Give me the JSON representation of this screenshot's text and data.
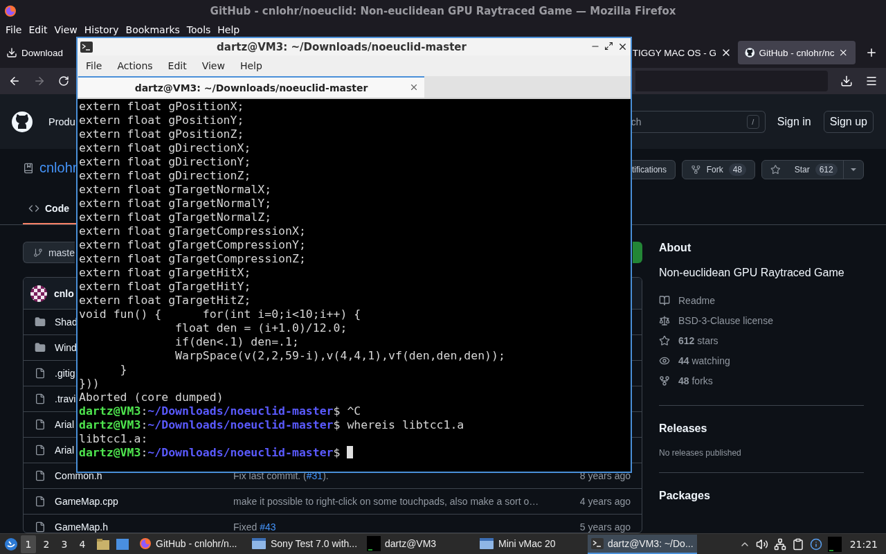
{
  "firefox": {
    "title": "GitHub - cnlohr/noeuclid: Non-euclidean GPU Raytraced Game — Mozilla Firefox",
    "menu": [
      "File",
      "Edit",
      "View",
      "History",
      "Bookmarks",
      "Tools",
      "Help"
    ],
    "tabs": [
      {
        "kind": "download",
        "label": "Download",
        "selected": false
      },
      {
        "kind": "plain",
        "label": "TIGGY MAC OS - G",
        "selected": false
      },
      {
        "kind": "site",
        "label": "GitHub - cnlohr/nc",
        "selected": true
      }
    ]
  },
  "github": {
    "header": {
      "nav_item": "Produ",
      "search_placeholder": "ch",
      "search_key": "/",
      "sign_in": "Sign in",
      "sign_up": "Sign up"
    },
    "repo": {
      "owner": "cnlohr",
      "notifications": "tifications",
      "fork": {
        "label": "Fork",
        "count": "48"
      },
      "star": {
        "label": "Star",
        "count": "612"
      }
    },
    "tabs": [
      {
        "label": "Code",
        "selected": true
      }
    ],
    "branch": "maste",
    "files": {
      "author": "cnlo",
      "rows": [
        {
          "kind": "folder",
          "name": "Shad"
        },
        {
          "kind": "folder",
          "name": "Wind"
        },
        {
          "kind": "file",
          "name": ".gitig"
        },
        {
          "kind": "file",
          "name": ".travi"
        },
        {
          "kind": "file",
          "name": "Arial"
        },
        {
          "kind": "file",
          "name": "Arial"
        },
        {
          "kind": "file",
          "name": "Common.h",
          "message": [
            {
              "text": "Fix last commit. (",
              "link": false
            },
            {
              "text": "#31",
              "link": true
            },
            {
              "text": ").",
              "link": false
            }
          ],
          "time": "8 years ago"
        },
        {
          "kind": "file",
          "name": "GameMap.cpp",
          "message": [
            {
              "text": "make it possible to right-click on some touchpads, also make a sort o…",
              "link": false
            }
          ],
          "time": "4 years ago"
        },
        {
          "kind": "file",
          "name": "GameMap.h",
          "message": [
            {
              "text": "Fixed ",
              "link": false
            },
            {
              "text": "#43",
              "link": true
            }
          ],
          "time": "5 years ago"
        }
      ]
    },
    "about": {
      "title": "About",
      "description": "Non-euclidean GPU Raytraced Game",
      "items": [
        {
          "kind": "readme",
          "text": "Readme"
        },
        {
          "kind": "license",
          "text": "BSD-3-Clause license"
        },
        {
          "kind": "stars",
          "text": "**612** stars"
        },
        {
          "kind": "watching",
          "text": "**44** watching"
        },
        {
          "kind": "forks",
          "text": "**48** forks"
        }
      ],
      "releases": {
        "title": "Releases",
        "note": "No releases published"
      },
      "packages": {
        "title": "Packages"
      }
    }
  },
  "terminal": {
    "title": "dartz@VM3: ~/Downloads/noeuclid-master",
    "menu": [
      "File",
      "Actions",
      "Edit",
      "View",
      "Help"
    ],
    "tab": "dartz@VM3: ~/Downloads/noeuclid-master",
    "lines": [
      {
        "kind": "text",
        "text": "extern float gPositionX;"
      },
      {
        "kind": "text",
        "text": "extern float gPositionY;"
      },
      {
        "kind": "text",
        "text": "extern float gPositionZ;"
      },
      {
        "kind": "text",
        "text": "extern float gDirectionX;"
      },
      {
        "kind": "text",
        "text": "extern float gDirectionY;"
      },
      {
        "kind": "text",
        "text": "extern float gDirectionZ;"
      },
      {
        "kind": "text",
        "text": "extern float gTargetNormalX;"
      },
      {
        "kind": "text",
        "text": "extern float gTargetNormalY;"
      },
      {
        "kind": "text",
        "text": "extern float gTargetNormalZ;"
      },
      {
        "kind": "text",
        "text": "extern float gTargetCompressionX;"
      },
      {
        "kind": "text",
        "text": "extern float gTargetCompressionY;"
      },
      {
        "kind": "text",
        "text": "extern float gTargetCompressionZ;"
      },
      {
        "kind": "text",
        "text": "extern float gTargetHitX;"
      },
      {
        "kind": "text",
        "text": "extern float gTargetHitY;"
      },
      {
        "kind": "text",
        "text": "extern float gTargetHitZ;"
      },
      {
        "kind": "text",
        "text": "void fun() {      for(int i=0;i<10;i++) {"
      },
      {
        "kind": "text",
        "text": "              float den = (i+1.0)/12.0;"
      },
      {
        "kind": "text",
        "text": "              if(den<.1) den=.1;"
      },
      {
        "kind": "text",
        "text": "              WarpSpace(v(2,2,59-i),v(4,4,1),vf(den,den,den));"
      },
      {
        "kind": "text",
        "text": "      }"
      },
      {
        "kind": "text",
        "text": "}))"
      },
      {
        "kind": "text",
        "text": "Aborted (core dumped)"
      },
      {
        "kind": "prompt",
        "user": "dartz@VM3",
        "colon": ":",
        "path": "~/Downloads/noeuclid-master",
        "command": "$ ^C",
        "cursor": false
      },
      {
        "kind": "prompt",
        "user": "dartz@VM3",
        "colon": ":",
        "path": "~/Downloads/noeuclid-master",
        "command": "$ whereis libtcc1.a",
        "cursor": false
      },
      {
        "kind": "text",
        "text": "libtcc1.a:"
      },
      {
        "kind": "prompt",
        "user": "dartz@VM3",
        "colon": ":",
        "path": "~/Downloads/noeuclid-master",
        "command": "$ ",
        "cursor": true
      }
    ]
  },
  "taskbar": {
    "workspaces": [
      {
        "label": "1",
        "selected": true
      },
      {
        "label": "2",
        "selected": false
      },
      {
        "label": "3",
        "selected": false
      },
      {
        "label": "4",
        "selected": false
      }
    ],
    "tasks": [
      {
        "kind": "browser",
        "label": "GitHub - cnlohr/n...",
        "selected": false
      },
      {
        "kind": "window",
        "label": "Sony Test 7.0 with...",
        "selected": false
      },
      {
        "kind": "console",
        "label": "dartz@VM3",
        "selected": false
      },
      {
        "kind": "window",
        "label": "Mini vMac 20",
        "selected": false
      },
      {
        "kind": "terminal",
        "label": "dartz@VM3: ~/Do...",
        "selected": true
      }
    ],
    "clock": "21:21"
  }
}
